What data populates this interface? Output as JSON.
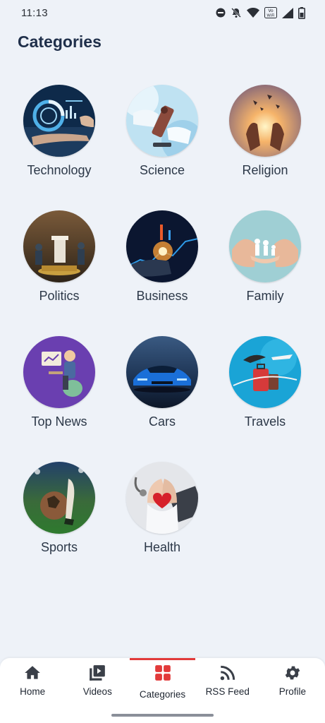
{
  "status_bar": {
    "time": "11:13",
    "icons": [
      "do-not-disturb-icon",
      "bell-off-icon",
      "wifi-icon",
      "vowifi-icon",
      "signal-icon",
      "battery-icon"
    ]
  },
  "page_title": "Categories",
  "categories": [
    {
      "label": "Technology",
      "icon": "technology-image"
    },
    {
      "label": "Science",
      "icon": "science-image"
    },
    {
      "label": "Religion",
      "icon": "religion-image"
    },
    {
      "label": "Politics",
      "icon": "politics-image"
    },
    {
      "label": "Business",
      "icon": "business-image"
    },
    {
      "label": "Family",
      "icon": "family-image"
    },
    {
      "label": "Top News",
      "icon": "top-news-image"
    },
    {
      "label": "Cars",
      "icon": "cars-image"
    },
    {
      "label": "Travels",
      "icon": "travels-image"
    },
    {
      "label": "Sports",
      "icon": "sports-image"
    },
    {
      "label": "Health",
      "icon": "health-image"
    }
  ],
  "bottom_nav": {
    "items": [
      {
        "label": "Home",
        "icon": "home-icon"
      },
      {
        "label": "Videos",
        "icon": "videos-icon"
      },
      {
        "label": "Categories",
        "icon": "grid-icon"
      },
      {
        "label": "RSS Feed",
        "icon": "rss-icon"
      },
      {
        "label": "Profile",
        "icon": "gear-icon"
      }
    ],
    "active": "Categories"
  },
  "colors": {
    "background": "#eef2f8",
    "title": "#1f2f4a",
    "accent": "#e23a3a"
  }
}
